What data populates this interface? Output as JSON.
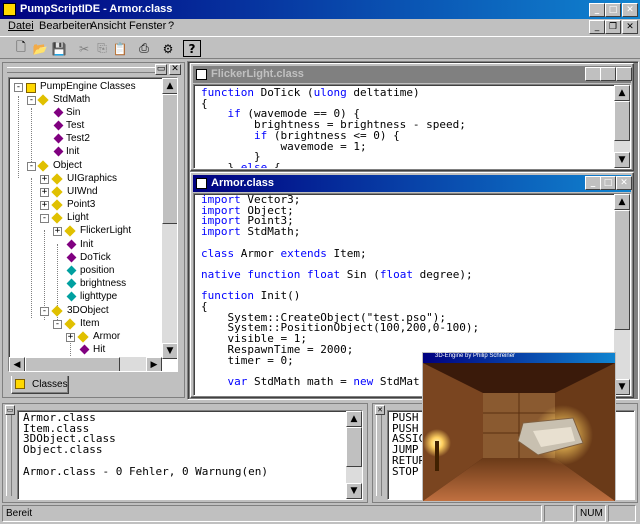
{
  "window": {
    "title": "PumpScriptIDE - Armor.class"
  },
  "menu": [
    "Datei",
    "Bearbeiten",
    "Ansicht",
    "Fenster",
    "?"
  ],
  "toolbar_icons": [
    "new-file-icon",
    "open-folder-icon",
    "save-icon",
    "cut-icon",
    "copy-icon",
    "paste-icon",
    "print-icon",
    "compile-icon",
    "help-icon"
  ],
  "tree": {
    "root": "PumpEngine Classes",
    "items": [
      "StdMath",
      "Sin",
      "Test",
      "Test2",
      "Init",
      "Object",
      "UIGraphics",
      "UIWnd",
      "Point3",
      "Light",
      "FlickerLight",
      "Init",
      "DoTick",
      "position",
      "brightness",
      "lighttype",
      "3DObject",
      "Item",
      "Armor",
      "Hit"
    ],
    "tab": "Classes"
  },
  "flicker_window": {
    "title": "FlickerLight.class",
    "lines": [
      [
        "function",
        " DoTick (",
        "ulong",
        " deltatime)"
      ],
      [
        "{"
      ],
      [
        "    ",
        "if",
        " (wavemode == 0) {"
      ],
      [
        "        brightness = brightness - speed;"
      ],
      [
        "        ",
        "if",
        " (brightness <= 0) {"
      ],
      [
        "            wavemode = 1;"
      ],
      [
        "        }"
      ],
      [
        "    } ",
        "else",
        " {"
      ]
    ]
  },
  "armor_window": {
    "title": "Armor.class",
    "lines": [
      "import Vector3;",
      "import Object;",
      "import Point3;",
      "import StdMath;",
      "",
      "class Armor extends Item;",
      "",
      "native function float Sin (float degree);",
      "",
      "function Init()",
      "{",
      "    System::CreateObject(\"test.pso\");",
      "    System::PositionObject(100,200,0-100);",
      "    visible = 1;",
      "    RespawnTime = 2000;",
      "    timer = 0;",
      "",
      "    var StdMath math = new StdMat"
    ]
  },
  "output": {
    "lines": [
      "Armor.class",
      "Item.class",
      "3DObject.class",
      "Object.class",
      "",
      "Armor.class - 0 Fehler, 0 Warnung(en)"
    ]
  },
  "asm": {
    "lines": [
      "PUSH",
      "PUSH",
      "ASSIC",
      "JUMP",
      "RETUR",
      "STOP"
    ]
  },
  "preview": {
    "title": "3D-Engine by Philip Schreiner"
  },
  "status": {
    "text": "Bereit",
    "num": "NUM"
  }
}
